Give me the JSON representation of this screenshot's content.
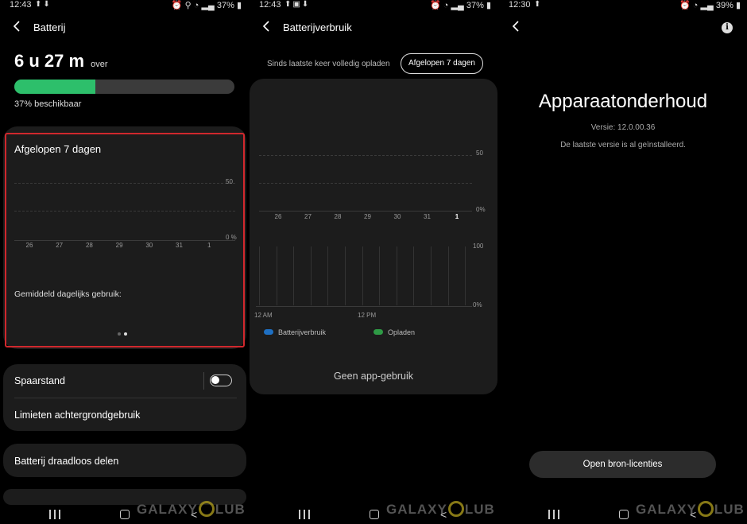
{
  "screen1": {
    "status": {
      "time": "12:43",
      "battery": "37%"
    },
    "header": {
      "title": "Batterij"
    },
    "remaining": {
      "value": "6 u 27 m",
      "suffix": "over"
    },
    "battery_level": 0.37,
    "available_text": "37% beschikbaar",
    "chart_card": {
      "title": "Afgelopen 7 dagen",
      "y_top_label": "50",
      "y_bottom_label": "0 %",
      "days": [
        "26",
        "27",
        "28",
        "29",
        "30",
        "31",
        "1"
      ],
      "avg_label": "Gemiddeld dagelijks gebruik:",
      "highlight_color": "#d0282d"
    },
    "settings": {
      "power_saving": "Spaarstand",
      "power_saving_on": false,
      "background_limits": "Limieten achtergrondgebruik",
      "wireless_share": "Batterij draadloos delen"
    },
    "accent_color": "#2dbf6b"
  },
  "screen2": {
    "status": {
      "time": "12:43",
      "battery": "37%"
    },
    "header": {
      "title": "Batterijverbruik"
    },
    "tabs": [
      {
        "label": "Sinds laatste keer volledig opladen"
      },
      {
        "label": "Afgelopen 7 dagen"
      }
    ],
    "upper_chart": {
      "y_top_label": "50",
      "y_bottom_label": "0%",
      "days": [
        "26",
        "27",
        "28",
        "29",
        "30",
        "31",
        "1"
      ],
      "selected_day": "1"
    },
    "lower_chart": {
      "y_top_label": "100",
      "y_bottom_label": "0%",
      "x_labels": [
        "12 AM",
        "12 PM"
      ]
    },
    "legend": [
      {
        "label": "Batterijverbruik",
        "color": "#1e6fc2"
      },
      {
        "label": "Opladen",
        "color": "#2e9a45"
      }
    ],
    "empty_message": "Geen app-gebruik"
  },
  "screen3": {
    "status": {
      "time": "12:30",
      "battery": "39%"
    },
    "title": "Apparaatonderhoud",
    "version": "Versie: 12.0.00.36",
    "installed_msg": "De laatste versie is al geïnstalleerd.",
    "open_button": "Open bron-licenties"
  },
  "watermark": {
    "left": "GALAXY",
    "right": "LUB"
  }
}
